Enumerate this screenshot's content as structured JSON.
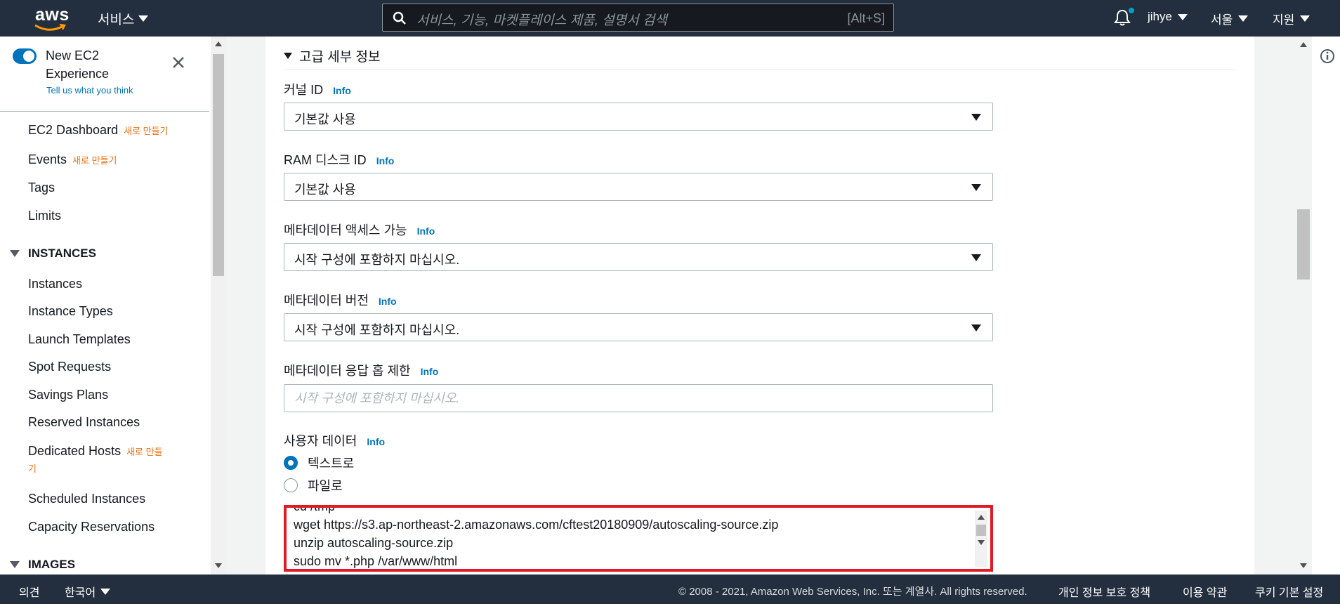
{
  "header": {
    "logo_text": "aws",
    "services_label": "서비스",
    "search": {
      "placeholder": "서비스, 기능, 마켓플레이스 제품, 설명서 검색",
      "shortcut": "[Alt+S]"
    },
    "user": "jihye",
    "region": "서울",
    "support": "지원"
  },
  "sidebar": {
    "new_experience": {
      "label": "New EC2 Experience",
      "feedback": "Tell us what you think",
      "enabled": true
    },
    "new_badge": "새로 만들기",
    "dedicated_badge_1": "새로 만들",
    "dedicated_badge_2": "기",
    "items": {
      "dashboard": "EC2 Dashboard",
      "events": "Events",
      "tags": "Tags",
      "limits": "Limits",
      "instances_section": "INSTANCES",
      "instances": "Instances",
      "instance_types": "Instance Types",
      "launch_templates": "Launch Templates",
      "spot_requests": "Spot Requests",
      "savings_plans": "Savings Plans",
      "reserved_instances": "Reserved Instances",
      "dedicated_hosts": "Dedicated Hosts",
      "scheduled_instances": "Scheduled Instances",
      "capacity_reservations": "Capacity Reservations",
      "images_section": "IMAGES"
    }
  },
  "main": {
    "advanced_title": "고급 세부 정보",
    "info": "Info",
    "kernel": {
      "label": "커널 ID",
      "value": "기본값 사용"
    },
    "ramdisk": {
      "label": "RAM 디스크 ID",
      "value": "기본값 사용"
    },
    "metadata_access": {
      "label": "메타데이터 액세스 가능",
      "value": "시작 구성에 포함하지 마십시오."
    },
    "metadata_version": {
      "label": "메타데이터 버전",
      "value": "시작 구성에 포함하지 마십시오."
    },
    "metadata_hop": {
      "label": "메타데이터 응답 홉 제한",
      "placeholder": "시작 구성에 포함하지 마십시오."
    },
    "user_data": {
      "label": "사용자 데이터",
      "options": {
        "text": "텍스트로",
        "file": "파일로"
      },
      "selected": "text",
      "lines": {
        "l0": "cd /tmp",
        "l1": "wget https://s3.ap-northeast-2.amazonaws.com/cftest20180909/autoscaling-source.zip",
        "l2": "unzip autoscaling-source.zip",
        "l3": "sudo mv *.php /var/www/html"
      }
    }
  },
  "footer": {
    "feedback": "의견",
    "language": "한국어",
    "copyright": "© 2008 - 2021, Amazon Web Services, Inc. 또는 계열사. All rights reserved.",
    "privacy": "개인 정보 보호 정책",
    "terms": "이용 약관",
    "cookies": "쿠키 기본 설정"
  },
  "colors": {
    "header_bg": "#232f3e",
    "link": "#0073bb",
    "badge": "#ec7211",
    "highlight_border": "#e01b24"
  }
}
